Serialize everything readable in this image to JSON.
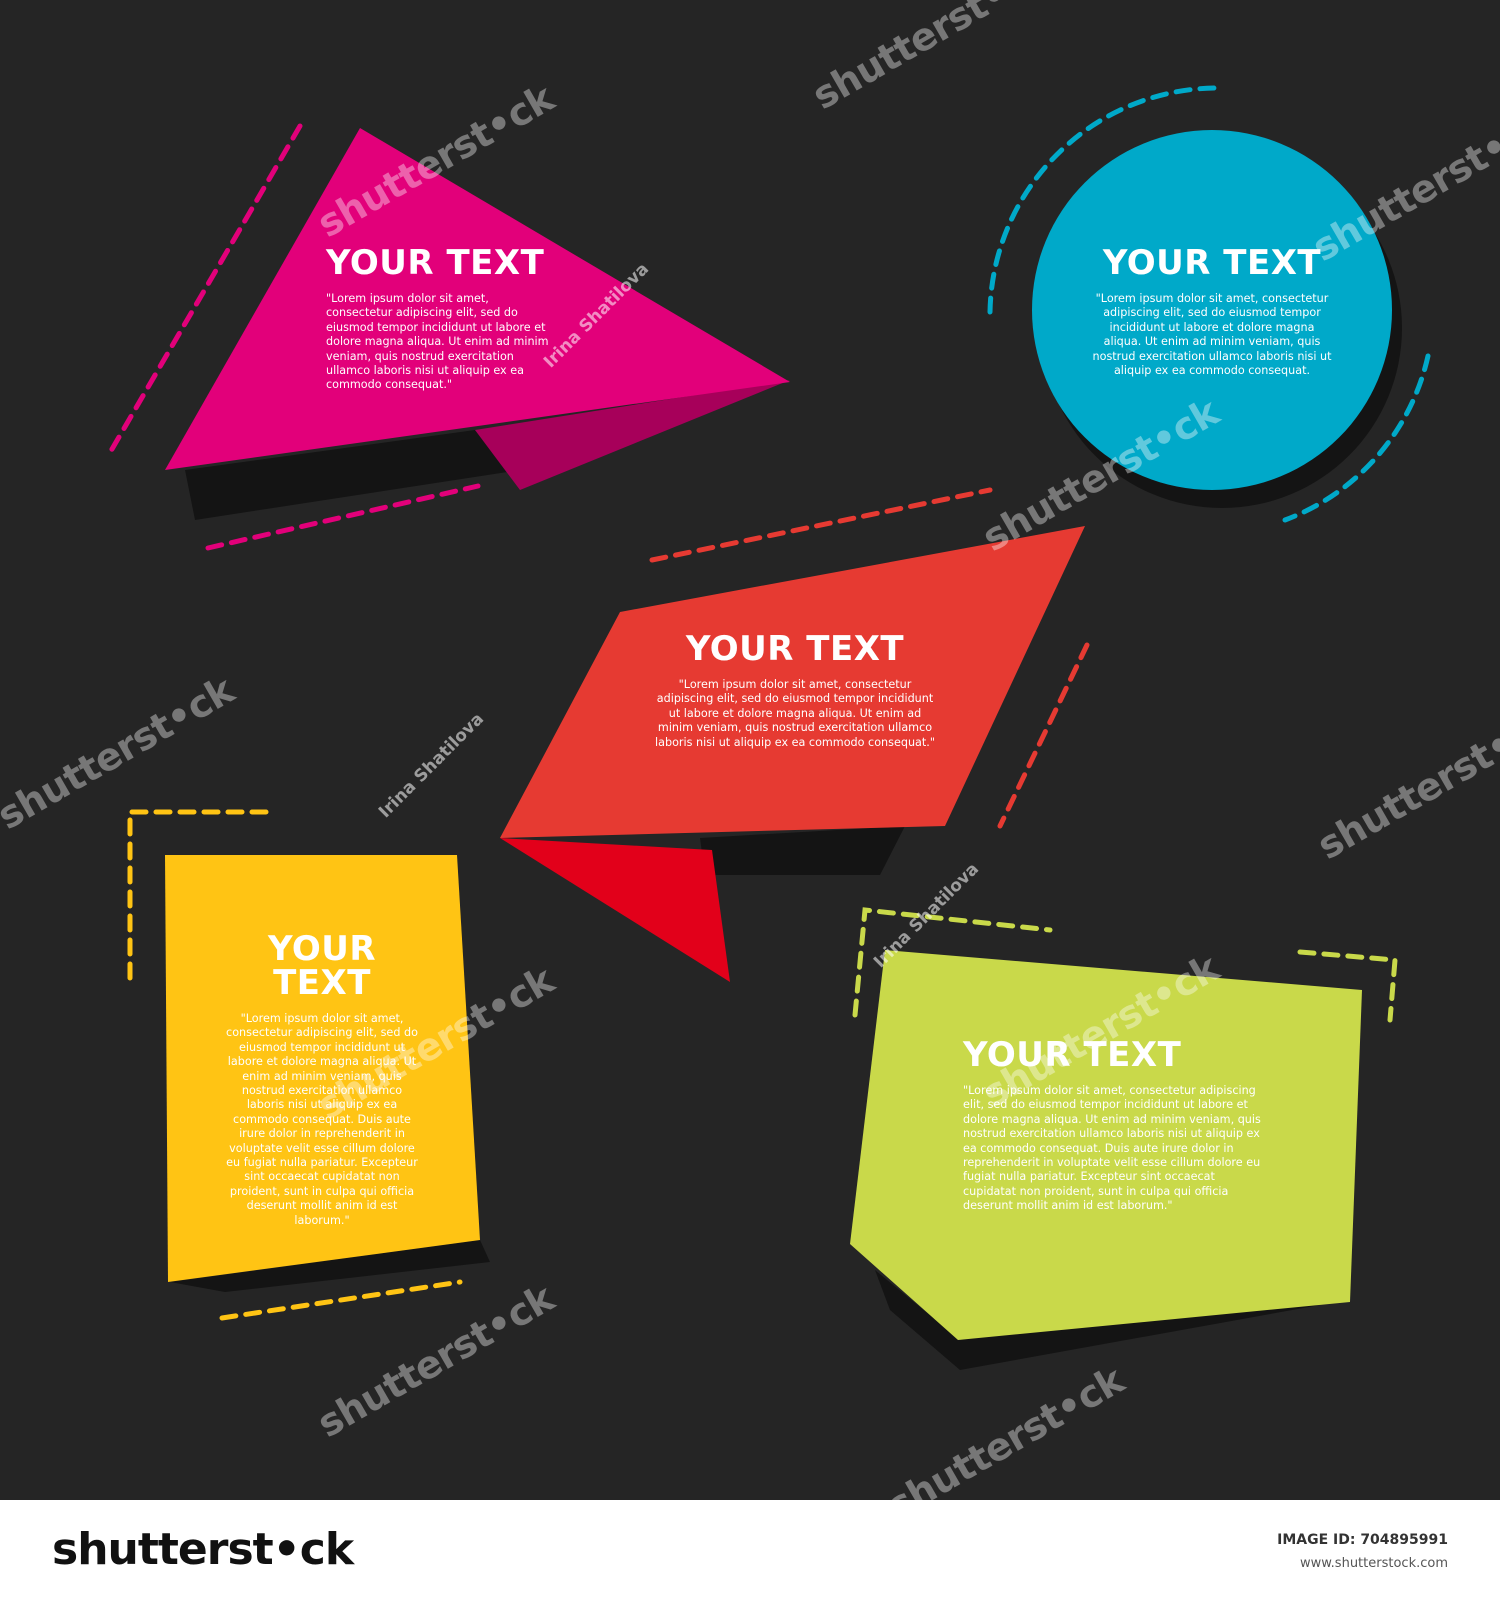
{
  "colors": {
    "background": "#252525",
    "magenta": "#e2007a",
    "cyan": "#00a9c9",
    "red": "#e63a32",
    "yellow": "#ffc414",
    "lime": "#c9d94a"
  },
  "boxes": {
    "magenta": {
      "title": "YOUR TEXT",
      "body": "\"Lorem ipsum dolor sit amet, consectetur adipiscing elit, sed do eiusmod tempor incididunt ut labore et dolore magna aliqua. Ut enim ad minim veniam, quis nostrud exercitation ullamco laboris nisi ut aliquip ex ea commodo consequat.\""
    },
    "cyan": {
      "title": "YOUR TEXT",
      "body": "\"Lorem ipsum dolor sit amet, consectetur adipiscing elit, sed do eiusmod tempor incididunt ut labore et dolore magna aliqua. Ut enim ad minim veniam, quis nostrud exercitation ullamco laboris nisi ut aliquip ex ea commodo consequat."
    },
    "red": {
      "title": "YOUR TEXT",
      "body": "\"Lorem ipsum dolor sit amet, consectetur adipiscing elit, sed do eiusmod tempor incididunt ut labore et dolore magna aliqua. Ut enim ad minim veniam, quis nostrud exercitation ullamco laboris nisi ut aliquip ex ea commodo consequat.\""
    },
    "yellow": {
      "title": "YOUR TEXT",
      "body": "\"Lorem ipsum dolor sit amet, consectetur adipiscing elit, sed do eiusmod tempor incididunt ut labore et dolore magna aliqua. Ut enim ad minim veniam, quis nostrud exercitation ullamco laboris nisi ut aliquip ex ea commodo consequat. Duis aute irure dolor in reprehenderit in voluptate velit esse cillum dolore eu fugiat nulla pariatur. Excepteur sint occaecat cupidatat non proident, sunt in culpa qui officia deserunt mollit anim id est laborum.\""
    },
    "lime": {
      "title": "YOUR TEXT",
      "body": "\"Lorem ipsum dolor sit amet, consectetur adipiscing elit, sed do eiusmod tempor incididunt ut labore et dolore magna aliqua. Ut enim ad minim veniam, quis nostrud exercitation ullamco laboris nisi ut aliquip ex ea commodo consequat. Duis aute irure dolor in reprehenderit in voluptate velit esse cillum dolore eu fugiat nulla pariatur. Excepteur sint occaecat cupidatat non proident, sunt in culpa qui officia deserunt mollit anim id est laborum.\""
    }
  },
  "watermark": {
    "brand": "shutterst•ck",
    "author": "Irina Shatilova"
  },
  "footer": {
    "logo": "shutterst•ck",
    "image_id": "IMAGE ID: 704895991",
    "url": "www.shutterstock.com"
  }
}
